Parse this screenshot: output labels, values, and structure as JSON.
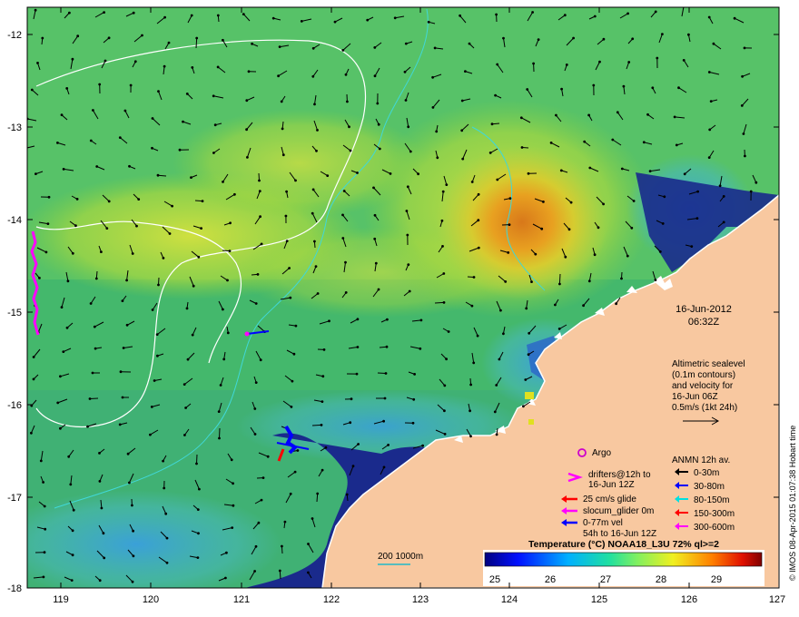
{
  "map": {
    "lon_range": [
      118.6,
      127.0
    ],
    "lat_range": [
      -18.0,
      -11.7
    ],
    "x_ticks": [
      "119",
      "120",
      "121",
      "122",
      "123",
      "124",
      "125",
      "126",
      "127"
    ],
    "y_ticks": [
      "-12",
      "-13",
      "-14",
      "-15",
      "-16",
      "-17",
      "-18"
    ]
  },
  "date": {
    "day": "16-Jun-2012",
    "time": "06:32Z"
  },
  "altimetry": {
    "line1": "Altimetric sealevel",
    "line2": "(0.1m contours)",
    "line3": "and velocity for",
    "line4": "16-Jun 06Z",
    "line5": "0.5m/s (1kt 24h)"
  },
  "argo": {
    "label": "Argo",
    "color": "#cc00cc"
  },
  "anmn": {
    "title": "ANMN 12h av.",
    "items": [
      {
        "label": "0-30m",
        "color": "#000000"
      },
      {
        "label": "30-80m",
        "color": "#0000ff"
      },
      {
        "label": "80-150m",
        "color": "#00e0e0"
      },
      {
        "label": "150-300m",
        "color": "#ff0000"
      },
      {
        "label": "300-600m",
        "color": "#ff00ff"
      }
    ]
  },
  "drifters": {
    "line1": "drifters@12h to",
    "line2": "16-Jun 12Z",
    "color": "#ff00ff"
  },
  "gliders": [
    {
      "label": "25 cm/s glide",
      "color": "#ff0000"
    },
    {
      "label": "slocum_glider 0m",
      "color": "#ff00ff"
    },
    {
      "label": "0-77m vel",
      "color": "#0000ff"
    }
  ],
  "glider_note": "54h to 16-Jun 12Z",
  "depth_label": "200  1000m",
  "colorbar": {
    "title": "Temperature (°C) NOAA18_L3U 72% ql>=2",
    "ticks": [
      "25",
      "26",
      "27",
      "28",
      "29"
    ],
    "min": 24.6,
    "max": 29.6
  },
  "credit": "© IMOS 08-Apr-2015 01:07:38 Hobart time",
  "colors": {
    "land": "#f8c8a0",
    "cool_water": "#3cb878",
    "warm_core": "#e08a10",
    "shelf_cold": "#1a2a8c"
  }
}
